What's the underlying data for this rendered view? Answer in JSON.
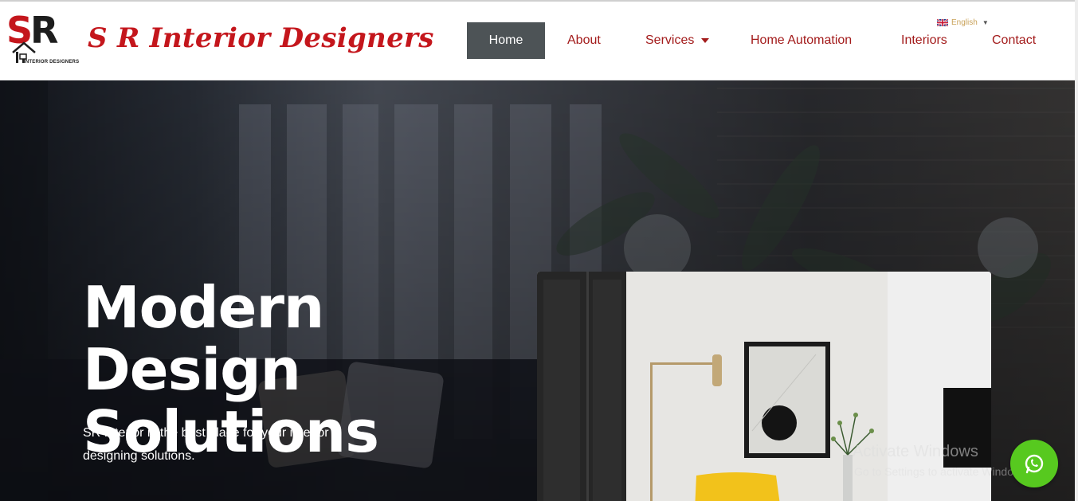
{
  "header": {
    "brand": "S R Interior Designers",
    "logo_tagline": "INTERIOR DESIGNERS",
    "logo_letters": "SR",
    "language": "English",
    "nav": [
      {
        "label": "Home",
        "active": true
      },
      {
        "label": "About"
      },
      {
        "label": "Services",
        "dropdown": true
      },
      {
        "label": "Home Automation"
      },
      {
        "label": "Interiors"
      },
      {
        "label": "Contact"
      }
    ]
  },
  "hero": {
    "title_line1": "Modern Design",
    "title_line2": "Solutions",
    "description": "SR Interior is the best place for your interior designing solutions."
  },
  "overlay": {
    "watermark_title": "Activate Windows",
    "watermark_sub": "Go to Settings to activate Windows.",
    "whatsapp_icon": "whatsapp-icon"
  },
  "colors": {
    "brand_red": "#c4161c",
    "nav_red": "#a31b1b",
    "nav_active_bg": "#4d5356",
    "whatsapp_green": "#57c91f"
  }
}
